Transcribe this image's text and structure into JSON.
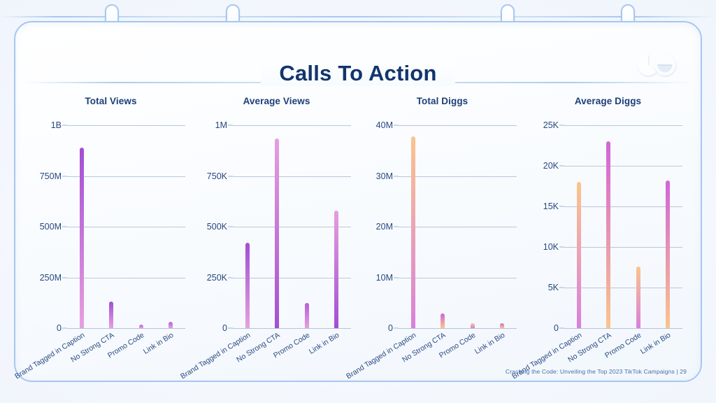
{
  "slide": {
    "title": "Calls To Action",
    "footer": "Cracking the Code: Unveiling the Top 2023 TikTok Campaigns |  29",
    "logo_name": "brand-logo"
  },
  "colors": {
    "title": "#12356c",
    "card_border": "#a6c8ef",
    "ring_border": "#a9c9ee",
    "grid": "#b9c8da",
    "axis_text": "#27477e",
    "footer_text": "#4a6fa5",
    "purple_top": "#9b4fd0",
    "pink_bottom": "#e79ede",
    "orange_top": "#fbc58c",
    "magenta": "#d264d8"
  },
  "categories": [
    "Brand Tagged in Caption",
    "No Strong CTA",
    "Promo Code",
    "Link in Bio"
  ],
  "chart_data": [
    {
      "type": "bar",
      "title": "Total Views",
      "xlabel": "",
      "ylabel": "",
      "categories": [
        "Brand Tagged in Caption",
        "No Strong CTA",
        "Promo Code",
        "Link in Bio"
      ],
      "values": [
        890000000,
        132000000,
        17000000,
        31000000
      ],
      "ylim": [
        0,
        1000000000
      ],
      "ticks": [
        0,
        250000000,
        500000000,
        750000000,
        1000000000
      ],
      "tick_labels": [
        "0",
        "250M",
        "500M",
        "750M",
        "1B"
      ],
      "grid": true,
      "legend": "none",
      "bar_gradients": [
        [
          "#a24fd2",
          "#e7a0e0"
        ],
        [
          "#a24fd2",
          "#e7a0e0"
        ],
        [
          "#b45fd6",
          "#e7a0e0"
        ],
        [
          "#b45fd6",
          "#e7a0e0"
        ]
      ]
    },
    {
      "type": "bar",
      "title": "Average Views",
      "xlabel": "",
      "ylabel": "",
      "categories": [
        "Brand Tagged in Caption",
        "No Strong CTA",
        "Promo Code",
        "Link in Bio"
      ],
      "values": [
        420000,
        935000,
        125000,
        580000
      ],
      "ylim": [
        0,
        1000000
      ],
      "ticks": [
        0,
        250000,
        500000,
        750000,
        1000000
      ],
      "tick_labels": [
        "0",
        "250K",
        "500K",
        "750K",
        "1M"
      ],
      "grid": true,
      "legend": "none",
      "bar_gradients": [
        [
          "#a24fd2",
          "#e7a0e0"
        ],
        [
          "#e79ede",
          "#a24fd2"
        ],
        [
          "#b45fd6",
          "#e7a0e0"
        ],
        [
          "#e79ede",
          "#a24fd2"
        ]
      ]
    },
    {
      "type": "bar",
      "title": "Total Diggs",
      "xlabel": "",
      "ylabel": "",
      "categories": [
        "Brand Tagged in Caption",
        "No Strong CTA",
        "Promo Code",
        "Link in Bio"
      ],
      "values": [
        37800000,
        2900000,
        900000,
        900000
      ],
      "ylim": [
        0,
        40000000
      ],
      "ticks": [
        0,
        10000000,
        20000000,
        30000000,
        40000000
      ],
      "tick_labels": [
        "0",
        "10M",
        "20M",
        "30M",
        "40M"
      ],
      "grid": true,
      "legend": "none",
      "bar_gradients": [
        [
          "#fbc58c",
          "#d97fdd"
        ],
        [
          "#d264d8",
          "#fbc58c"
        ],
        [
          "#fbc58c",
          "#d97fdd"
        ],
        [
          "#d264d8",
          "#fbc58c"
        ]
      ]
    },
    {
      "type": "bar",
      "title": "Average Diggs",
      "xlabel": "",
      "ylabel": "",
      "categories": [
        "Brand Tagged in Caption",
        "No Strong CTA",
        "Promo Code",
        "Link in Bio"
      ],
      "values": [
        18000,
        23000,
        7600,
        18200
      ],
      "ylim": [
        0,
        25000
      ],
      "ticks": [
        0,
        5000,
        10000,
        15000,
        20000,
        25000
      ],
      "tick_labels": [
        "0",
        "5K",
        "10K",
        "15K",
        "20K",
        "25K"
      ],
      "grid": true,
      "legend": "none",
      "bar_gradients": [
        [
          "#fbc58c",
          "#d97fdd"
        ],
        [
          "#d264d8",
          "#fbc58c"
        ],
        [
          "#fbc58c",
          "#d97fdd"
        ],
        [
          "#d264d8",
          "#fbc58c"
        ]
      ]
    }
  ]
}
